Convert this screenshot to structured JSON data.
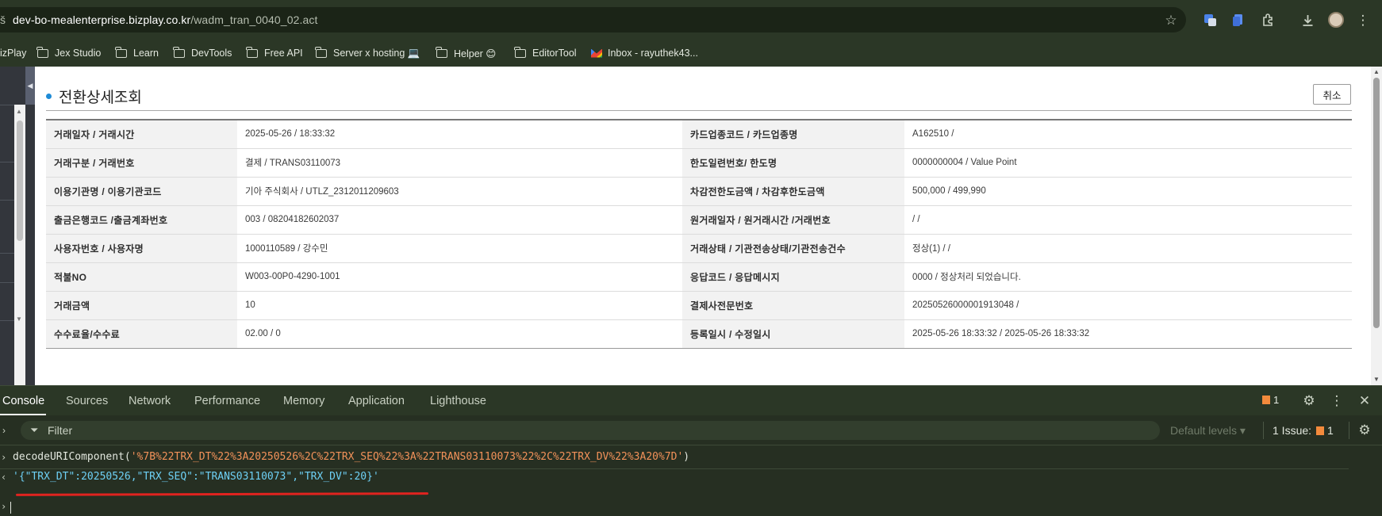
{
  "browser": {
    "url_prefix": "š",
    "url_host": "dev-bo-mealenterprise.bizplay.co.kr",
    "url_path": "/wadm_tran_0040_02.act",
    "bookmarks": [
      {
        "label": "izPlay",
        "icon": "none"
      },
      {
        "label": "Jex Studio",
        "icon": "folder-icon"
      },
      {
        "label": "Learn",
        "icon": "folder-icon"
      },
      {
        "label": "DevTools",
        "icon": "folder-icon"
      },
      {
        "label": "Free API",
        "icon": "folder-icon"
      },
      {
        "label": "Server x hosting 💻",
        "icon": "folder-icon"
      },
      {
        "label": "Helper 😊",
        "icon": "folder-icon"
      },
      {
        "label": "EditorTool",
        "icon": "folder-icon"
      },
      {
        "label": "Inbox - rayuthek43...",
        "icon": "gmail-icon"
      }
    ]
  },
  "page": {
    "title": "전환상세조회",
    "cancel_label": "취소",
    "rows": [
      {
        "k1": "거래일자 / 거래시간",
        "v1": "2025-05-26 / 18:33:32",
        "k2": "카드업종코드 / 카드업종명",
        "v2": "A162510 /"
      },
      {
        "k1": "거래구분 / 거래번호",
        "v1": "결제 / TRANS03110073",
        "k2": "한도일련번호/ 한도명",
        "v2": "0000000004 / Value Point"
      },
      {
        "k1": "이용기관명 / 이용기관코드",
        "v1": "기아 주식회사 / UTLZ_2312011209603",
        "k2": "차감전한도금액 / 차감후한도금액",
        "v2": "500,000 / 499,990"
      },
      {
        "k1": "출금은행코드 /출금계좌번호",
        "v1": "003 / 08204182602037",
        "k2": "원거래일자 / 원거래시간 /거래번호",
        "v2": "/ /"
      },
      {
        "k1": "사용자번호 / 사용자명",
        "v1": "1000110589 / 강수민",
        "k2": "거래상태 / 기관전송상태/기관전송건수",
        "v2": "정상(1) / /"
      },
      {
        "k1": "적불NO",
        "v1": "W003-00P0-4290-1001",
        "k2": "응답코드 / 응답메시지",
        "v2": "0000 / 정상처리 되었습니다."
      },
      {
        "k1": "거래금액",
        "v1": "10",
        "k2": "결제사전문번호",
        "v2": "20250526000001913048 /"
      },
      {
        "k1": "수수료율/수수료",
        "v1": "02.00 / 0",
        "k2": "등록일시 / 수정일시",
        "v2": "2025-05-26 18:33:32 / 2025-05-26 18:33:32"
      }
    ]
  },
  "devtools": {
    "tabs": [
      "Console",
      "Sources",
      "Network",
      "Performance",
      "Memory",
      "Application",
      "Lighthouse"
    ],
    "issue_badge_count": "1",
    "filter_placeholder": "Filter",
    "levels_label": "Default levels ▾",
    "issues_label": "1 Issue:",
    "issues_count": "1",
    "console": {
      "input_fn": "decodeURIComponent(",
      "input_arg": "'%7B%22TRX_DT%22%3A20250526%2C%22TRX_SEQ%22%3A%22TRANS03110073%22%2C%22TRX_DV%22%3A20%7D'",
      "input_close": ")",
      "output": "'{\"TRX_DT\":20250526,\"TRX_SEQ\":\"TRANS03110073\",\"TRX_DV\":20}'"
    }
  },
  "colors": {
    "accent_bullet": "#1e8bd6",
    "chrome_bg": "#2b3726",
    "console_string": "#f3925a",
    "console_result": "#6ed0f5",
    "annotation_red": "#e0231f"
  }
}
